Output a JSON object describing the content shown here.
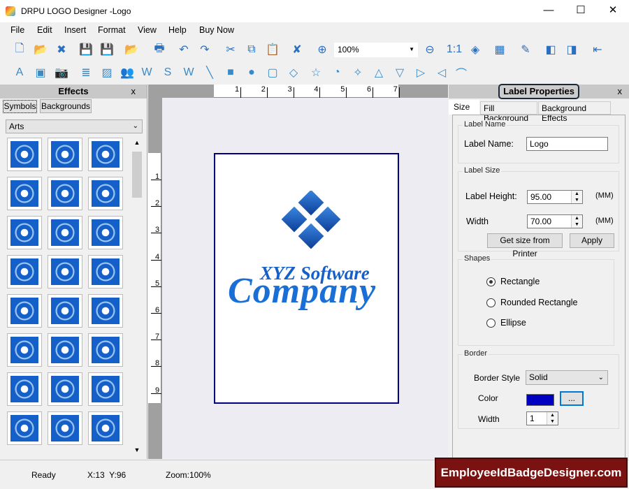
{
  "window": {
    "title": "DRPU LOGO Designer -Logo",
    "minimize": "—",
    "maximize": "☐",
    "close": "✕"
  },
  "menu": [
    "File",
    "Edit",
    "Insert",
    "Format",
    "View",
    "Help",
    "Buy Now"
  ],
  "toolbar1": [
    "new-icon",
    "open-icon",
    "close-file-icon",
    "save-icon",
    "save-as-icon",
    "open-recent-icon",
    "print-icon",
    "undo-icon",
    "redo-icon",
    "cut-icon",
    "copy-icon",
    "paste-icon",
    "delete-icon",
    "zoom-in-icon",
    "zoom-out-icon",
    "actual-size-icon",
    "fit-icon",
    "grid-icon",
    "edit-icon",
    "bring-front-icon",
    "send-back-icon",
    "align-left-icon"
  ],
  "zoom_combo": {
    "value": "100%"
  },
  "toolbar2": [
    "text-icon",
    "image-icon",
    "camera-icon",
    "layers-icon",
    "background-icon",
    "users-icon",
    "word-art-icon",
    "signature-icon",
    "watermark-icon",
    "line-icon",
    "rectangle-icon",
    "ellipse-icon",
    "rounded-rectangle-icon",
    "diamond-icon",
    "star-icon",
    "pie-icon",
    "four-point-star-icon",
    "triangle-icon",
    "triangle-down-icon",
    "triangle-right-icon",
    "triangle-left-icon",
    "arc-icon"
  ],
  "effects": {
    "title": "Effects",
    "close": "x",
    "tabs": [
      "Symbols",
      "Backgrounds"
    ],
    "category": "Arts",
    "symbol_count": 24
  },
  "ruler": {
    "h": [
      "1",
      "2",
      "3",
      "4",
      "5",
      "6",
      "7"
    ],
    "v": [
      "1",
      "2",
      "3",
      "4",
      "5",
      "6",
      "7",
      "8",
      "9"
    ]
  },
  "logo": {
    "line1": "XYZ Software",
    "line2": "Company",
    "color": "#1560c8"
  },
  "props": {
    "title": "Label Properties",
    "close": "x",
    "tabs": [
      "Size",
      "Fill Background",
      "Background Effects"
    ],
    "label_name_group": "Label Name",
    "label_name_label": "Label Name:",
    "label_name_value": "Logo",
    "size_group": "Label Size",
    "height_label": "Label Height:",
    "height_value": "95.00",
    "width_label": "Width",
    "width_value": "70.00",
    "unit": "(MM)",
    "get_size_btn": "Get size from Printer",
    "apply_btn": "Apply",
    "shapes_group": "Shapes",
    "shapes": [
      "Rectangle",
      "Rounded Rectangle",
      "Ellipse"
    ],
    "selected_shape": "Rectangle",
    "border_group": "Border",
    "border_style_label": "Border Style",
    "border_style_value": "Solid",
    "color_label": "Color",
    "border_color": "#0000c0",
    "color_btn": "...",
    "width_val": "1"
  },
  "status": {
    "state": "Ready",
    "coords": "X:13  Y:96",
    "zoom": "Zoom:100%"
  },
  "watermark": "EmployeeIdBadgeDesigner.com"
}
